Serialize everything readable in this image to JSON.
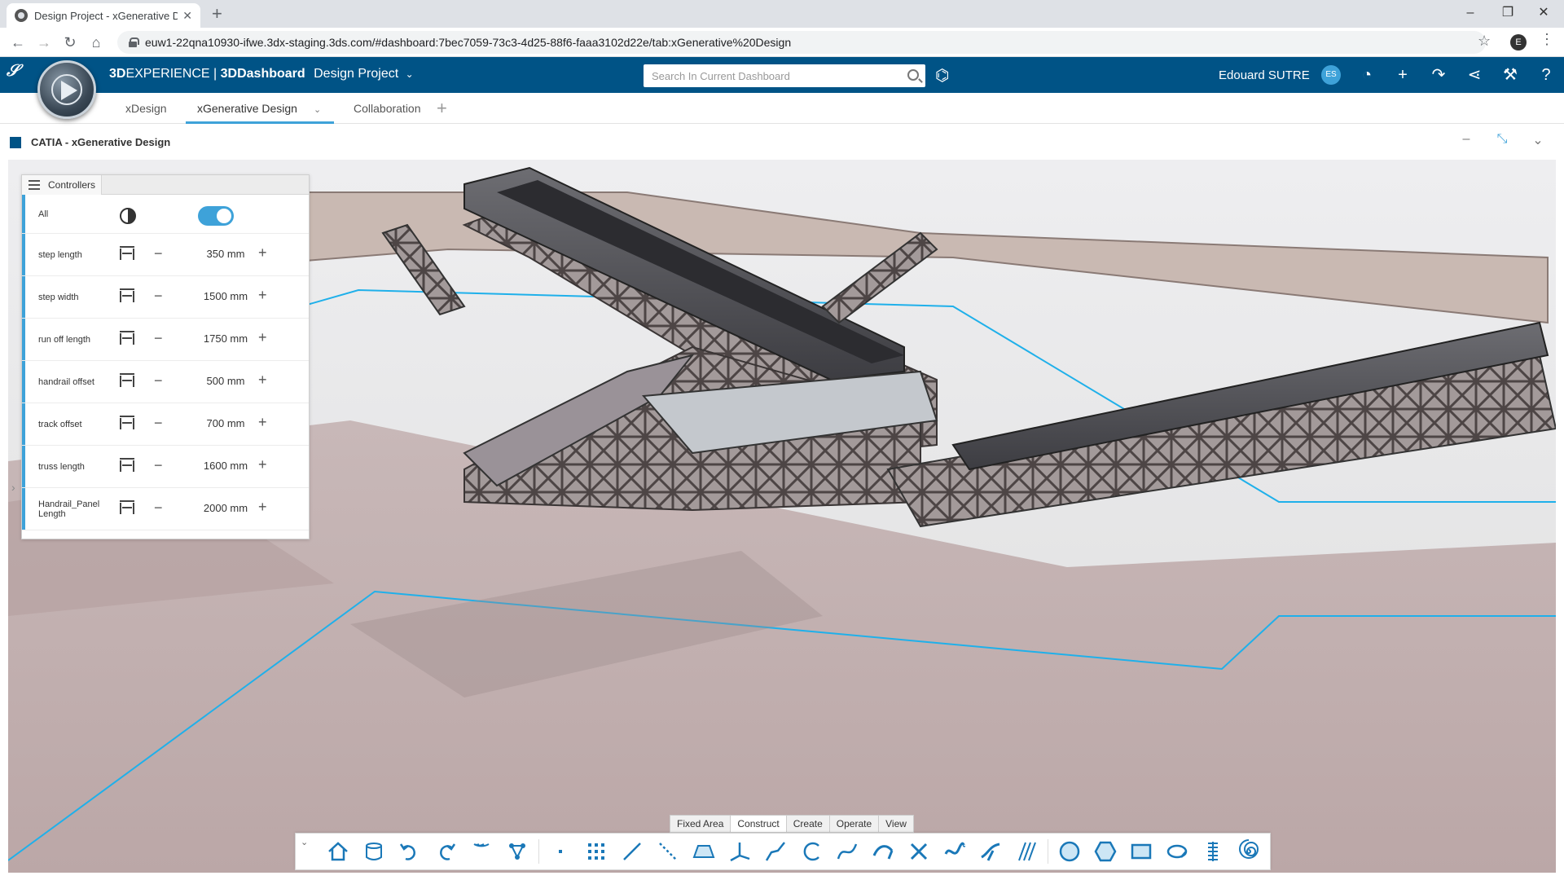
{
  "browser": {
    "tab_title": "Design Project - xGenerative De",
    "url": "euw1-22qna10930-ifwe.3dx-staging.3ds.com/#dashboard:7bec7059-73c3-4d25-88f6-faaa3102d22e/tab:xGenerative%20Design",
    "profile_initial": "E"
  },
  "appbar": {
    "brand_part1": "3D",
    "brand_part2": "EXPERIENCE | ",
    "brand_part3": "3DDashboard",
    "dashboard_name": "Design Project",
    "search_placeholder": "Search In Current Dashboard",
    "user_name": "Edouard SUTRE",
    "user_initials": "ES"
  },
  "dashboard_tabs": [
    {
      "label": "xDesign"
    },
    {
      "label": "xGenerative Design"
    },
    {
      "label": "Collaboration"
    }
  ],
  "app": {
    "title": "CATIA - xGenerative Design"
  },
  "controllers": {
    "tab_label": "Controllers",
    "all_label": "All",
    "rows": [
      {
        "label": "step length",
        "value": "350 mm"
      },
      {
        "label": "step width",
        "value": "1500 mm"
      },
      {
        "label": "run off length",
        "value": "1750 mm"
      },
      {
        "label": "handrail offset",
        "value": "500 mm"
      },
      {
        "label": "track offset",
        "value": "700 mm"
      },
      {
        "label": "truss length",
        "value": "1600 mm"
      },
      {
        "label": "Handrail_Panel Length",
        "value": "2000 mm"
      }
    ]
  },
  "action_sections": [
    "Fixed Area",
    "Construct",
    "Create",
    "Operate",
    "View"
  ],
  "colors": {
    "accent": "#3ea2d9",
    "appbar": "#005386"
  }
}
